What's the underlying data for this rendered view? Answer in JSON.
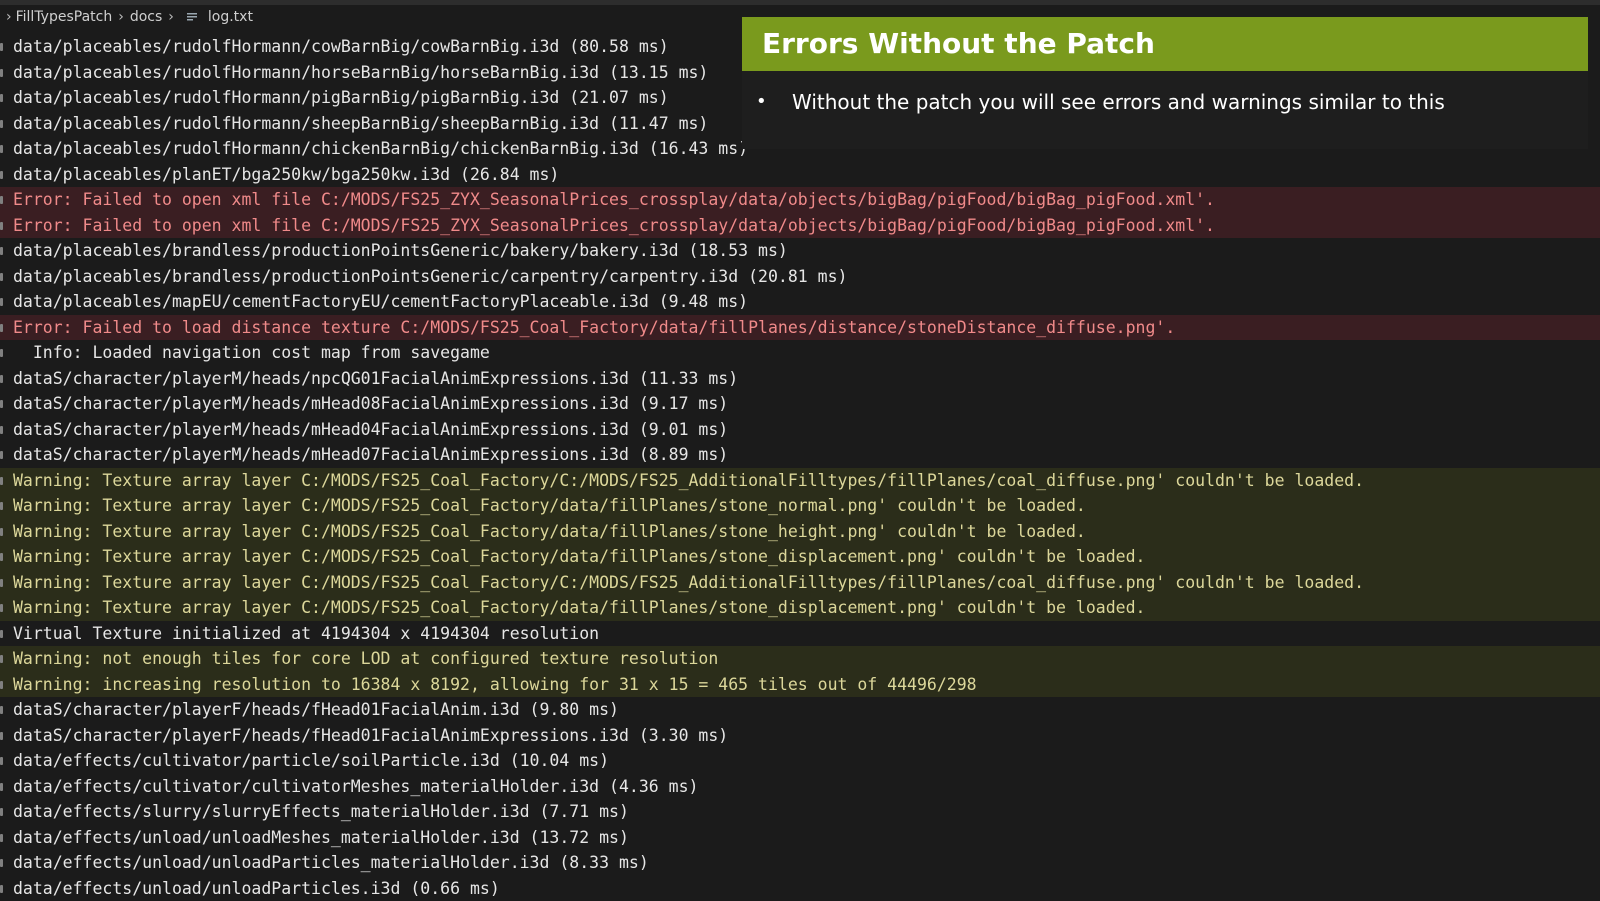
{
  "breadcrumb": {
    "items": [
      "FillTypesPatch",
      "docs",
      "log.txt"
    ]
  },
  "overlay": {
    "title": "Errors Without the Patch",
    "bullet": "•",
    "text": "Without the patch you will see errors and warnings similar to this"
  },
  "log": [
    {
      "type": "normal",
      "text": "data/placeables/rudolfHormann/cowBarnBig/cowBarnBig.i3d (80.58 ms)"
    },
    {
      "type": "normal",
      "text": "data/placeables/rudolfHormann/horseBarnBig/horseBarnBig.i3d (13.15 ms)"
    },
    {
      "type": "normal",
      "text": "data/placeables/rudolfHormann/pigBarnBig/pigBarnBig.i3d (21.07 ms)"
    },
    {
      "type": "normal",
      "text": "data/placeables/rudolfHormann/sheepBarnBig/sheepBarnBig.i3d (11.47 ms)"
    },
    {
      "type": "normal",
      "text": "data/placeables/rudolfHormann/chickenBarnBig/chickenBarnBig.i3d (16.43 ms)"
    },
    {
      "type": "normal",
      "text": "data/placeables/planET/bga250kw/bga250kw.i3d (26.84 ms)"
    },
    {
      "type": "error",
      "text": "Error: Failed to open xml file C:/MODS/FS25_ZYX_SeasonalPrices_crossplay/data/objects/bigBag/pigFood/bigBag_pigFood.xml'."
    },
    {
      "type": "error",
      "text": "Error: Failed to open xml file C:/MODS/FS25_ZYX_SeasonalPrices_crossplay/data/objects/bigBag/pigFood/bigBag_pigFood.xml'."
    },
    {
      "type": "normal",
      "text": "data/placeables/brandless/productionPointsGeneric/bakery/bakery.i3d (18.53 ms)"
    },
    {
      "type": "normal",
      "text": "data/placeables/brandless/productionPointsGeneric/carpentry/carpentry.i3d (20.81 ms)"
    },
    {
      "type": "normal",
      "text": "data/placeables/mapEU/cementFactoryEU/cementFactoryPlaceable.i3d (9.48 ms)"
    },
    {
      "type": "error",
      "text": "Error: Failed to load distance texture C:/MODS/FS25_Coal_Factory/data/fillPlanes/distance/stoneDistance_diffuse.png'."
    },
    {
      "type": "info",
      "text": "  Info: Loaded navigation cost map from savegame"
    },
    {
      "type": "normal",
      "text": "dataS/character/playerM/heads/npcQG01FacialAnimExpressions.i3d (11.33 ms)"
    },
    {
      "type": "normal",
      "text": "dataS/character/playerM/heads/mHead08FacialAnimExpressions.i3d (9.17 ms)"
    },
    {
      "type": "normal",
      "text": "dataS/character/playerM/heads/mHead04FacialAnimExpressions.i3d (9.01 ms)"
    },
    {
      "type": "normal",
      "text": "dataS/character/playerM/heads/mHead07FacialAnimExpressions.i3d (8.89 ms)"
    },
    {
      "type": "warning",
      "text": "Warning: Texture array layer C:/MODS/FS25_Coal_Factory/C:/MODS/FS25_AdditionalFilltypes/fillPlanes/coal_diffuse.png' couldn't be loaded."
    },
    {
      "type": "warning",
      "text": "Warning: Texture array layer C:/MODS/FS25_Coal_Factory/data/fillPlanes/stone_normal.png' couldn't be loaded."
    },
    {
      "type": "warning",
      "text": "Warning: Texture array layer C:/MODS/FS25_Coal_Factory/data/fillPlanes/stone_height.png' couldn't be loaded."
    },
    {
      "type": "warning",
      "text": "Warning: Texture array layer C:/MODS/FS25_Coal_Factory/data/fillPlanes/stone_displacement.png' couldn't be loaded."
    },
    {
      "type": "warning",
      "text": "Warning: Texture array layer C:/MODS/FS25_Coal_Factory/C:/MODS/FS25_AdditionalFilltypes/fillPlanes/coal_diffuse.png' couldn't be loaded."
    },
    {
      "type": "warning",
      "text": "Warning: Texture array layer C:/MODS/FS25_Coal_Factory/data/fillPlanes/stone_displacement.png' couldn't be loaded."
    },
    {
      "type": "normal",
      "text": "Virtual Texture initialized at 4194304 x 4194304 resolution"
    },
    {
      "type": "warning",
      "text": "Warning: not enough tiles for core LOD at configured texture resolution"
    },
    {
      "type": "warning",
      "text": "Warning: increasing resolution to 16384 x 8192, allowing for 31 x 15 = 465 tiles out of 44496/298"
    },
    {
      "type": "normal",
      "text": "dataS/character/playerF/heads/fHead01FacialAnim.i3d (9.80 ms)"
    },
    {
      "type": "normal",
      "text": "dataS/character/playerF/heads/fHead01FacialAnimExpressions.i3d (3.30 ms)"
    },
    {
      "type": "normal",
      "text": "data/effects/cultivator/particle/soilParticle.i3d (10.04 ms)"
    },
    {
      "type": "normal",
      "text": "data/effects/cultivator/cultivatorMeshes_materialHolder.i3d (4.36 ms)"
    },
    {
      "type": "normal",
      "text": "data/effects/slurry/slurryEffects_materialHolder.i3d (7.71 ms)"
    },
    {
      "type": "normal",
      "text": "data/effects/unload/unloadMeshes_materialHolder.i3d (13.72 ms)"
    },
    {
      "type": "normal",
      "text": "data/effects/unload/unloadParticles_materialHolder.i3d (8.33 ms)"
    },
    {
      "type": "normal",
      "text": "data/effects/unload/unloadParticles.i3d (0.66 ms)"
    }
  ]
}
